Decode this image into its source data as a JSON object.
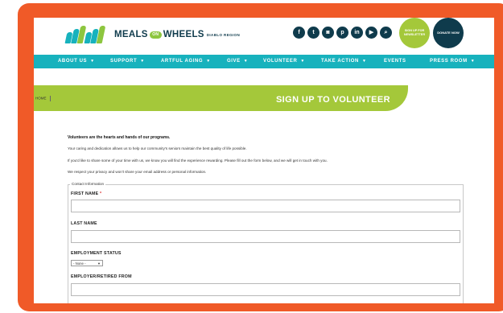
{
  "header": {
    "logo": {
      "word1": "MEALS",
      "on": "ON",
      "word2": "WHEELS",
      "region": "DIABLO REGION",
      "bar_colors": [
        "#17b2bd",
        "#17b2bd",
        "#8dc63f",
        "#17b2bd",
        "#17b2bd",
        "#8dc63f"
      ]
    },
    "social_icons": [
      {
        "name": "facebook-icon",
        "glyph": "f"
      },
      {
        "name": "twitter-icon",
        "glyph": "t"
      },
      {
        "name": "instagram-icon",
        "glyph": "◙"
      },
      {
        "name": "pinterest-icon",
        "glyph": "p"
      },
      {
        "name": "linkedin-icon",
        "glyph": "in"
      },
      {
        "name": "youtube-icon",
        "glyph": "▶"
      },
      {
        "name": "search-icon",
        "glyph": "⌕"
      }
    ],
    "cta_signup": "SIGN UP FOR NEWSLETTER",
    "cta_donate": "DONATE NOW"
  },
  "nav": {
    "items": [
      {
        "label": "ABOUT US",
        "caret": "▼"
      },
      {
        "label": "SUPPORT",
        "caret": "▼"
      },
      {
        "label": "ARTFUL AGING",
        "caret": "▼"
      },
      {
        "label": "GIVE",
        "caret": "▼"
      },
      {
        "label": "VOLUNTEER",
        "caret": "▼"
      },
      {
        "label": "TAKE ACTION",
        "caret": "▼"
      },
      {
        "label": "EVENTS",
        "caret": ""
      },
      {
        "label": "PRESS ROOM",
        "caret": "▼"
      }
    ]
  },
  "breadcrumb": {
    "home": "HOME"
  },
  "banner": {
    "title": "SIGN UP TO VOLUNTEER"
  },
  "intro": {
    "heading": "Volunteers are the hearts and hands of our programs.",
    "p1": "Your caring and dedication allows us to help our community's seniors maintain the best quality of life possible.",
    "p2": "If you'd like to share some of your time with us, we know you will find the experience rewarding. Please fill out the form below, and we will get in touch with you.",
    "p3": "We respect your privacy and won't share your email address or personal information."
  },
  "form": {
    "legend": "Contact Information",
    "first_name": {
      "label": "FIRST NAME",
      "required": "*",
      "value": ""
    },
    "last_name": {
      "label": "LAST NAME",
      "value": ""
    },
    "employment_status": {
      "label": "EMPLOYMENT STATUS",
      "selected": "- None -",
      "arrow": "▼"
    },
    "employer": {
      "label": "EMPLOYER/RETIRED FROM",
      "value": ""
    }
  },
  "colors": {
    "frame": "#f05a28",
    "navy": "#0f3b4c",
    "teal": "#17b2bd",
    "green": "#a4c83a"
  }
}
